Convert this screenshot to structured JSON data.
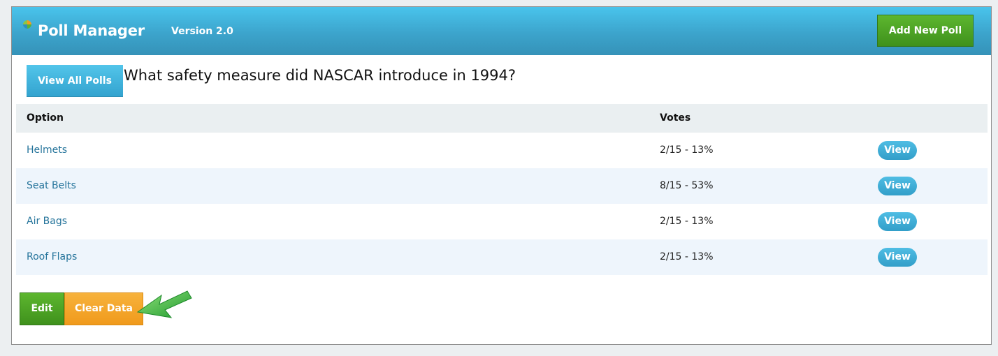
{
  "header": {
    "app_title": "Poll Manager",
    "version": "Version 2.0",
    "add_new_poll_label": "Add New Poll",
    "logo_icon": "leaf-logo-icon"
  },
  "poll": {
    "view_all_label": "View All Polls",
    "question": "What safety measure did NASCAR introduce in 1994?"
  },
  "table": {
    "columns": [
      "Option",
      "Votes"
    ],
    "rows": [
      {
        "option": "Helmets",
        "votes": "2/15 - 13%",
        "action": "View"
      },
      {
        "option": "Seat Belts",
        "votes": "8/15 - 53%",
        "action": "View"
      },
      {
        "option": "Air Bags",
        "votes": "2/15 - 13%",
        "action": "View"
      },
      {
        "option": "Roof Flaps",
        "votes": "2/15 - 13%",
        "action": "View"
      }
    ]
  },
  "actions": {
    "edit_label": "Edit",
    "clear_label": "Clear Data",
    "pointer_icon": "green-arrow-icon"
  },
  "colors": {
    "header_blue": "#3ca4cc",
    "button_green": "#4ca426",
    "button_orange": "#f5a62a",
    "link_blue": "#25749b"
  }
}
